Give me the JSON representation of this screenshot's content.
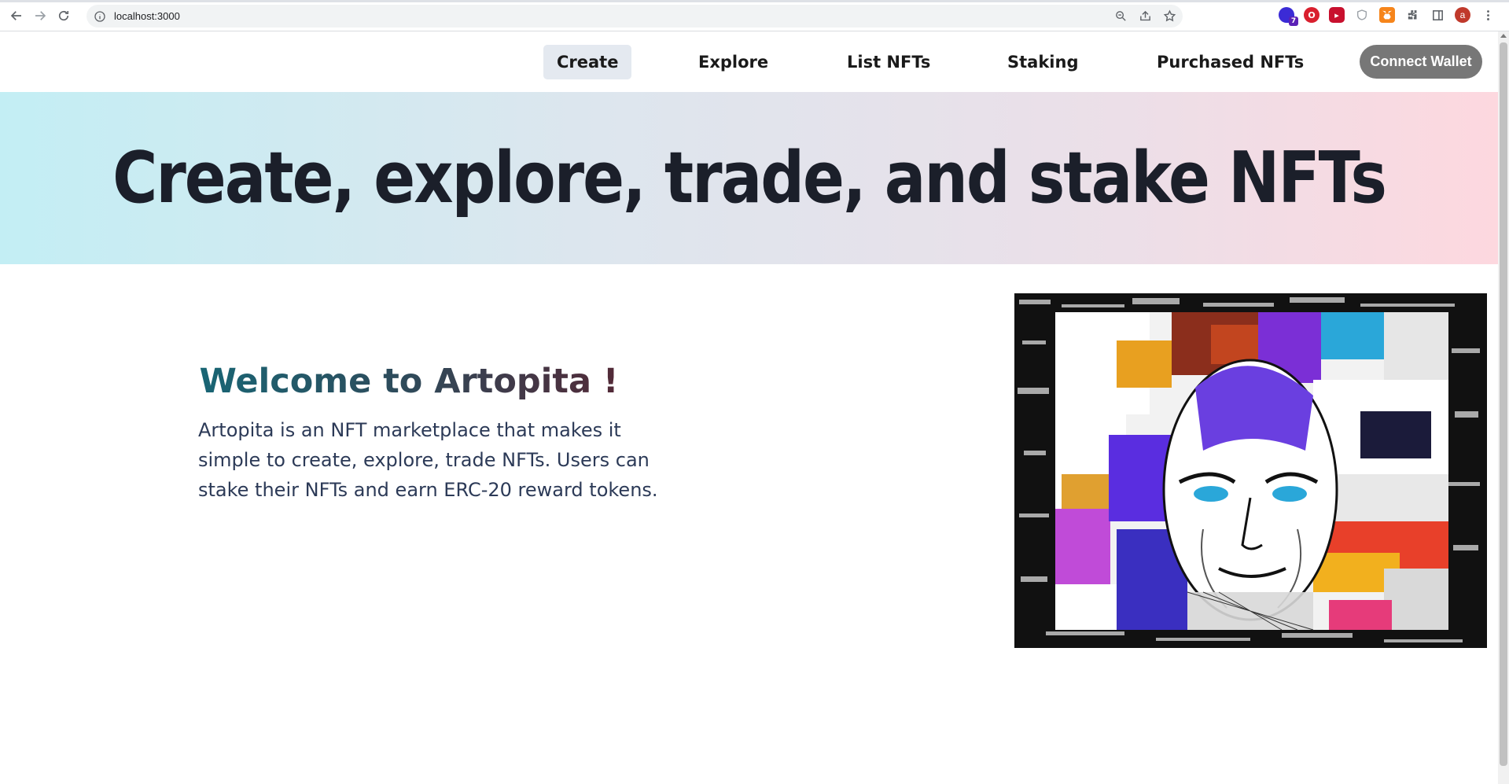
{
  "browser": {
    "url": "localhost:3000",
    "extension_badge_count": "7",
    "profile_initial": "a"
  },
  "nav": {
    "links": [
      {
        "label": "Create",
        "active": true
      },
      {
        "label": "Explore",
        "active": false
      },
      {
        "label": "List NFTs",
        "active": false
      },
      {
        "label": "Staking",
        "active": false
      },
      {
        "label": "Purchased NFTs",
        "active": false
      }
    ],
    "connect_label": "Connect Wallet"
  },
  "hero": {
    "title": "Create, explore, trade, and stake NFTs"
  },
  "welcome": {
    "title": "Welcome to Artopita !",
    "description": "Artopita is an NFT marketplace that makes it simple to create, explore, trade NFTs. Users can stake their NFTs and earn ERC-20 reward tokens."
  },
  "colors": {
    "nav_active_bg": "#e4e9f0",
    "connect_bg": "#777777",
    "hero_start": "#c3eef4",
    "hero_end": "#fdd8df",
    "title_teal": "#146b7a",
    "title_maroon": "#5a2330",
    "body_text": "#2c3a57"
  },
  "icons": {
    "back": "arrow-left-icon",
    "forward": "arrow-right-icon",
    "reload": "reload-icon",
    "site_info": "info-icon",
    "zoom": "zoom-icon",
    "share": "share-icon",
    "bookmark": "star-icon",
    "artwork": "nft-artwork-image"
  }
}
